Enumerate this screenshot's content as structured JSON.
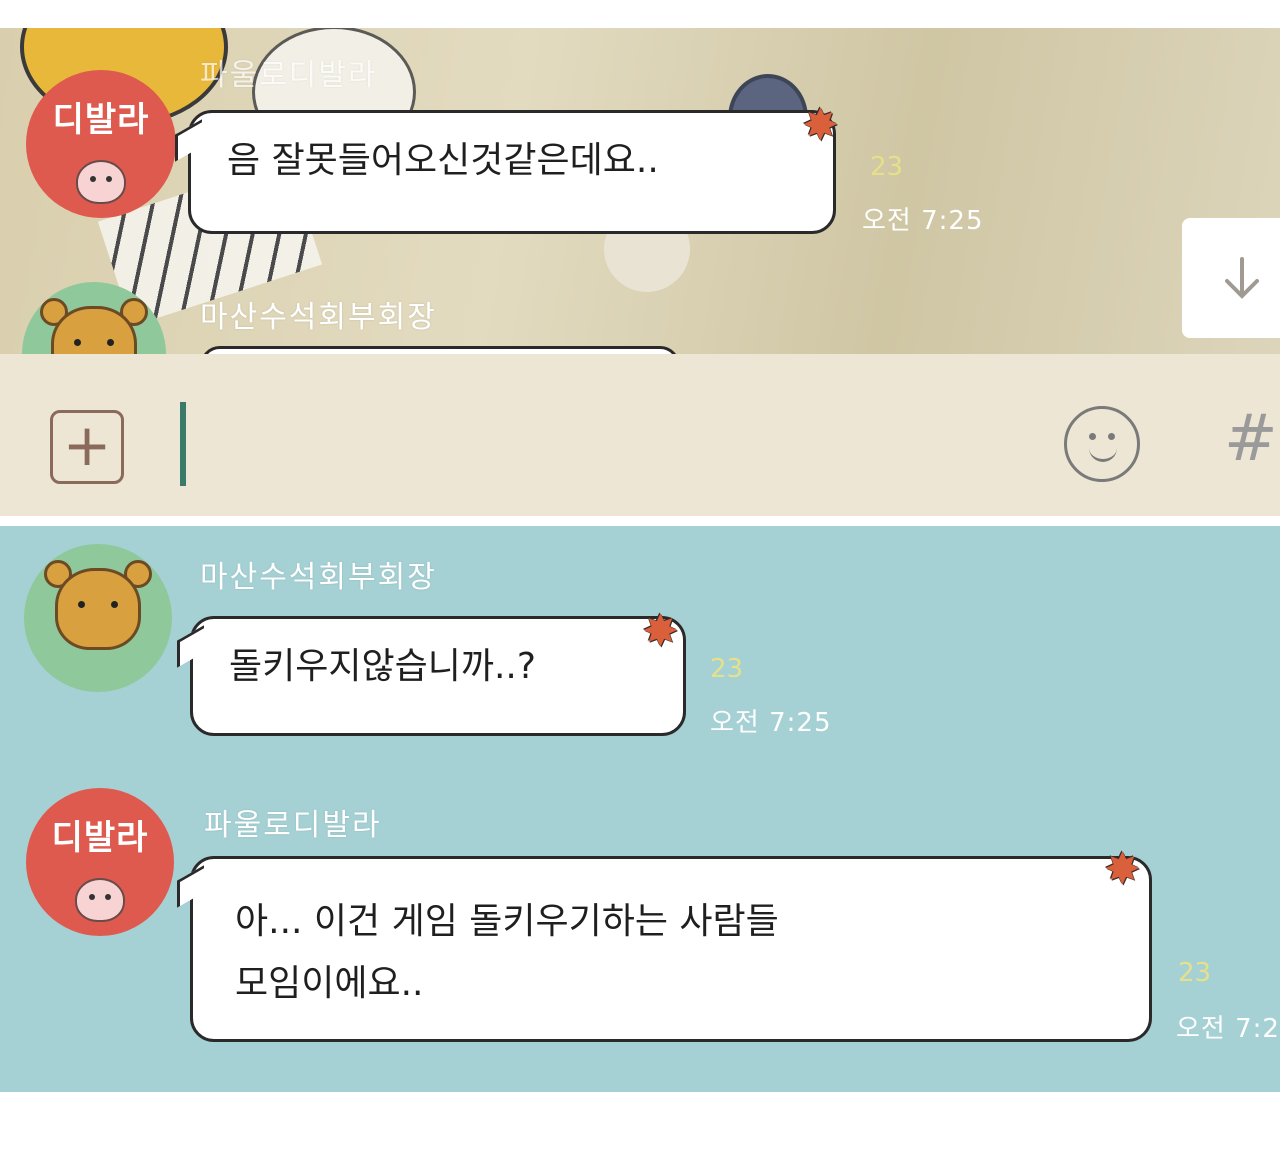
{
  "top": {
    "avatar_label": "디발라",
    "sender_name": "파울로디발라",
    "message": "음 잘못들어오신것같은데요..",
    "unread_count": "23",
    "time": "오전 7:25",
    "next_sender_name": "마산수석회부회장",
    "scroll_icon": "arrow-down-icon",
    "plus_icon": "plus-icon",
    "emoji_icon": "smiley-icon",
    "hash_label": "#"
  },
  "bottom": {
    "msg1": {
      "sender_name": "마산수석회부회장",
      "text": "돌키우지않습니까..?",
      "unread_count": "23",
      "time": "오전 7:25"
    },
    "msg2": {
      "avatar_label": "디발라",
      "sender_name": "파울로디발라",
      "line1": "아... 이건 게임 돌키우기하는 사람들",
      "line2": "모임이에요..",
      "unread_count": "23",
      "time": "오전 7:2"
    }
  },
  "colors": {
    "top_bg": "#e3dbc0",
    "bottom_bg": "#a5d1d5",
    "bubble": "#ffffff",
    "apeach_avatar": "#df5a4e",
    "ryan_avatar": "#8fc89a",
    "star": "#d9603a"
  }
}
